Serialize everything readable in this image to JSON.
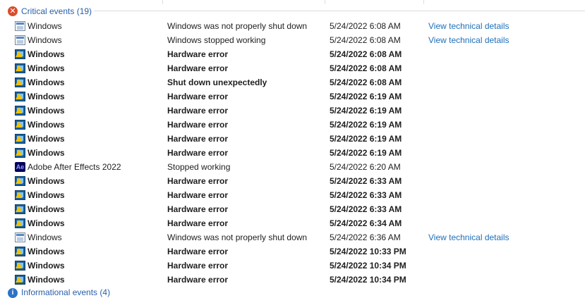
{
  "critical_group": {
    "title": "Critical events (19)"
  },
  "info_group": {
    "title": "Informational events (4)"
  },
  "rows": [
    {
      "source": "Windows",
      "summary": "Windows was not properly shut down",
      "date": "5/24/2022 6:08 AM",
      "link": "View technical details",
      "icon": "windows-window-icon",
      "bold": false
    },
    {
      "source": "Windows",
      "summary": "Windows stopped working",
      "date": "5/24/2022 6:08 AM",
      "link": "View technical details",
      "icon": "windows-window-icon",
      "bold": false
    },
    {
      "source": "Windows",
      "summary": "Hardware error",
      "date": "5/24/2022 6:08 AM",
      "link": "",
      "icon": "hardware-warning-icon",
      "bold": true
    },
    {
      "source": "Windows",
      "summary": "Hardware error",
      "date": "5/24/2022 6:08 AM",
      "link": "",
      "icon": "hardware-warning-icon",
      "bold": true
    },
    {
      "source": "Windows",
      "summary": "Shut down unexpectedly",
      "date": "5/24/2022 6:08 AM",
      "link": "",
      "icon": "hardware-warning-icon",
      "bold": true
    },
    {
      "source": "Windows",
      "summary": "Hardware error",
      "date": "5/24/2022 6:19 AM",
      "link": "",
      "icon": "hardware-warning-icon",
      "bold": true
    },
    {
      "source": "Windows",
      "summary": "Hardware error",
      "date": "5/24/2022 6:19 AM",
      "link": "",
      "icon": "hardware-warning-icon",
      "bold": true
    },
    {
      "source": "Windows",
      "summary": "Hardware error",
      "date": "5/24/2022 6:19 AM",
      "link": "",
      "icon": "hardware-warning-icon",
      "bold": true
    },
    {
      "source": "Windows",
      "summary": "Hardware error",
      "date": "5/24/2022 6:19 AM",
      "link": "",
      "icon": "hardware-warning-icon",
      "bold": true
    },
    {
      "source": "Windows",
      "summary": "Hardware error",
      "date": "5/24/2022 6:19 AM",
      "link": "",
      "icon": "hardware-warning-icon",
      "bold": true
    },
    {
      "source": "Adobe After Effects 2022",
      "summary": "Stopped working",
      "date": "5/24/2022 6:20 AM",
      "link": "",
      "icon": "after-effects-icon",
      "bold": false
    },
    {
      "source": "Windows",
      "summary": "Hardware error",
      "date": "5/24/2022 6:33 AM",
      "link": "",
      "icon": "hardware-warning-icon",
      "bold": true
    },
    {
      "source": "Windows",
      "summary": "Hardware error",
      "date": "5/24/2022 6:33 AM",
      "link": "",
      "icon": "hardware-warning-icon",
      "bold": true
    },
    {
      "source": "Windows",
      "summary": "Hardware error",
      "date": "5/24/2022 6:33 AM",
      "link": "",
      "icon": "hardware-warning-icon",
      "bold": true
    },
    {
      "source": "Windows",
      "summary": "Hardware error",
      "date": "5/24/2022 6:34 AM",
      "link": "",
      "icon": "hardware-warning-icon",
      "bold": true
    },
    {
      "source": "Windows",
      "summary": "Windows was not properly shut down",
      "date": "5/24/2022 6:36 AM",
      "link": "View technical details",
      "icon": "windows-window-icon",
      "bold": false
    },
    {
      "source": "Windows",
      "summary": "Hardware error",
      "date": "5/24/2022 10:33 PM",
      "link": "",
      "icon": "hardware-warning-icon",
      "bold": true
    },
    {
      "source": "Windows",
      "summary": "Hardware error",
      "date": "5/24/2022 10:34 PM",
      "link": "",
      "icon": "hardware-warning-icon",
      "bold": true
    },
    {
      "source": "Windows",
      "summary": "Hardware error",
      "date": "5/24/2022 10:34 PM",
      "link": "",
      "icon": "hardware-warning-icon",
      "bold": true
    }
  ],
  "colors": {
    "link": "#1f6fb9",
    "group_title": "#2a5fa8",
    "critical_icon": "#d94c2b",
    "info_icon": "#2c72c7"
  }
}
